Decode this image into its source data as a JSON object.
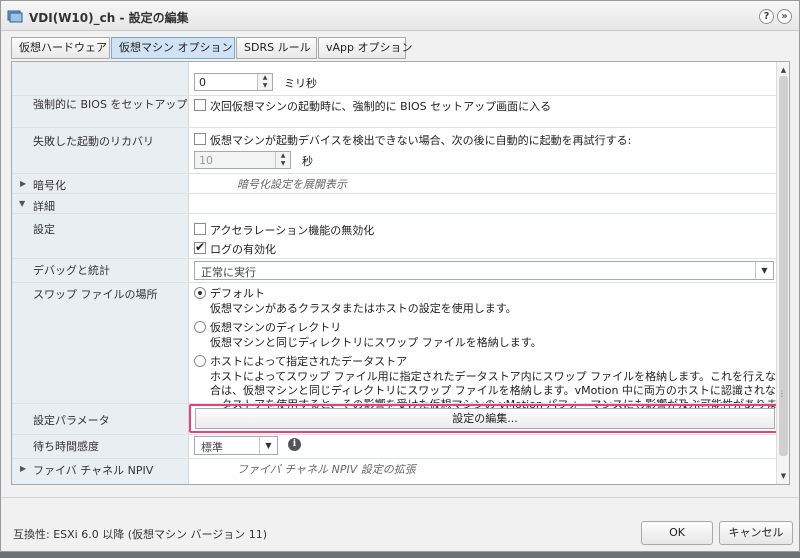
{
  "dialog": {
    "title": "VDI(W10)_ch - 設定の編集",
    "help_label": "?",
    "expand_label": "»"
  },
  "tabs": [
    {
      "label": "仮想ハードウェア"
    },
    {
      "label": "仮想マシン オプション"
    },
    {
      "label": "SDRS ルール"
    },
    {
      "label": "vApp オプション"
    }
  ],
  "boot": {
    "delay_value": "0",
    "delay_unit": "ミリ秒",
    "force_bios_label": "強制的に BIOS をセットアップ",
    "force_bios_text": "次回仮想マシンの起動時に、強制的に BIOS セットアップ画面に入る",
    "failed_boot_label": "失敗した起動のリカバリ",
    "failed_boot_text": "仮想マシンが起動デバイスを検出できない場合、次の後に自動的に起動を再試行する:",
    "retry_value": "10",
    "retry_unit": "秒"
  },
  "encryption": {
    "label": "暗号化",
    "hint": "暗号化設定を展開表示"
  },
  "advanced": {
    "label": "詳細",
    "settings_label": "設定",
    "disable_accel": "アクセラレーション機能の無効化",
    "enable_logging": "ログの有効化",
    "debug_label": "デバッグと統計",
    "debug_value": "正常に実行",
    "swap_label": "スワップ ファイルの場所",
    "swap_default_title": "デフォルト",
    "swap_default_desc": "仮想マシンがあるクラスタまたはホストの設定を使用します。",
    "swap_vmdir_title": "仮想マシンのディレクトリ",
    "swap_vmdir_desc": "仮想マシンと同じディレクトリにスワップ ファイルを格納します。",
    "swap_host_title": "ホストによって指定されたデータストア",
    "swap_host_desc_1": "ホストによってスワップ ファイル用に指定されたデータストア内にスワップ ファイルを格納します。これを行えない場",
    "swap_host_desc_2": "合は、仮想マシンと同じディレクトリにスワップ ファイルを格納します。vMotion 中に両方のホストに認識されないデ",
    "swap_host_desc_3": "ータストアを使用すると、その影響を受けた仮想マシンの vMotion パフォーマンスにも影響が及ぶ可能性があります。",
    "config_params_label": "設定パラメータ",
    "edit_config_button": "設定の編集...",
    "latency_label": "待ち時間感度",
    "latency_value": "標準",
    "info_symbol": "i"
  },
  "fibre": {
    "label": "ファイバ チャネル NPIV",
    "hint": "ファイバ チャネル NPIV 設定の拡張"
  },
  "footer": {
    "compat": "互換性: ESXi 6.0 以降 (仮想マシン バージョン 11)",
    "ok": "OK",
    "cancel": "キャンセル"
  },
  "colors": {
    "highlight": "#e8417a",
    "active_tab": "#cfe3f5"
  }
}
